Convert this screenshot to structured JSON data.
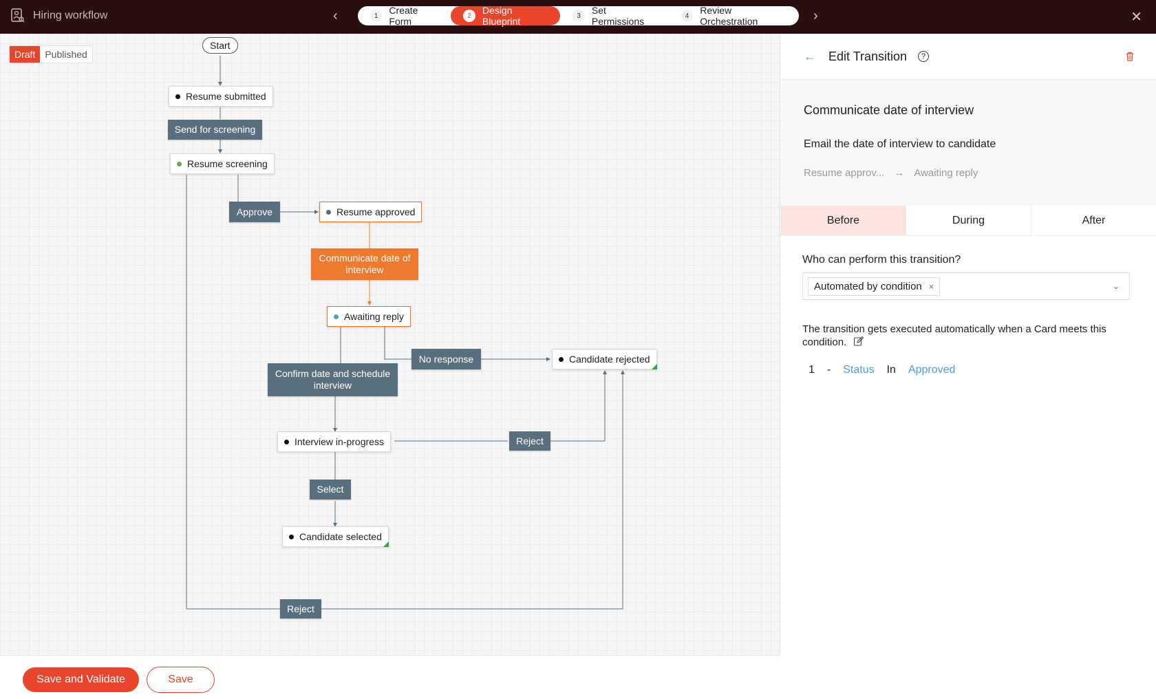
{
  "header": {
    "app_title": "Hiring workflow",
    "steps": [
      {
        "num": "1",
        "label": "Create Form"
      },
      {
        "num": "2",
        "label": "Design Blueprint"
      },
      {
        "num": "3",
        "label": "Set Permissions"
      },
      {
        "num": "4",
        "label": "Review Orchestration"
      }
    ],
    "prev_icon": "‹",
    "next_icon": "›",
    "close_icon": "✕"
  },
  "canvas": {
    "toggle": {
      "draft": "Draft",
      "published": "Published"
    },
    "start": "Start",
    "states": {
      "resume_submitted": "Resume submitted",
      "resume_screening": "Resume screening",
      "resume_approved": "Resume approved",
      "awaiting_reply": "Awaiting reply",
      "candidate_rejected": "Candidate rejected",
      "interview_in_progress": "Interview in-progress",
      "candidate_selected": "Candidate selected"
    },
    "transitions": {
      "send_for_screening": "Send for screening",
      "approve": "Approve",
      "communicate": "Communicate date of interview",
      "no_response": "No response",
      "confirm_date": "Confirm date and schedule interview",
      "reject_1": "Reject",
      "select": "Select",
      "reject_2": "Reject"
    }
  },
  "footer": {
    "save_validate": "Save and Validate",
    "save": "Save"
  },
  "panel": {
    "title": "Edit Transition",
    "back_icon": "←",
    "help_icon": "?",
    "transition_name": "Communicate date of interview",
    "description": "Email the date of interview to candidate",
    "from_state": "Resume approv...",
    "arrow": "→",
    "to_state": "Awaiting reply",
    "tabs": [
      "Before",
      "During",
      "After"
    ],
    "question": "Who can perform this transition?",
    "performer": "Automated by condition",
    "remove_icon": "×",
    "caret_icon": "⌄",
    "note": "The transition gets executed automatically when a Card meets this condition.",
    "condition": {
      "index": "1",
      "dash": "-",
      "field": "Status",
      "op": "In",
      "value": "Approved"
    }
  },
  "colors": {
    "accent": "#e8452c",
    "transition": "#5a6f7e",
    "active_transition": "#ee7a2e",
    "link": "#4a9fe0",
    "topbar": "#2a0f0f"
  }
}
